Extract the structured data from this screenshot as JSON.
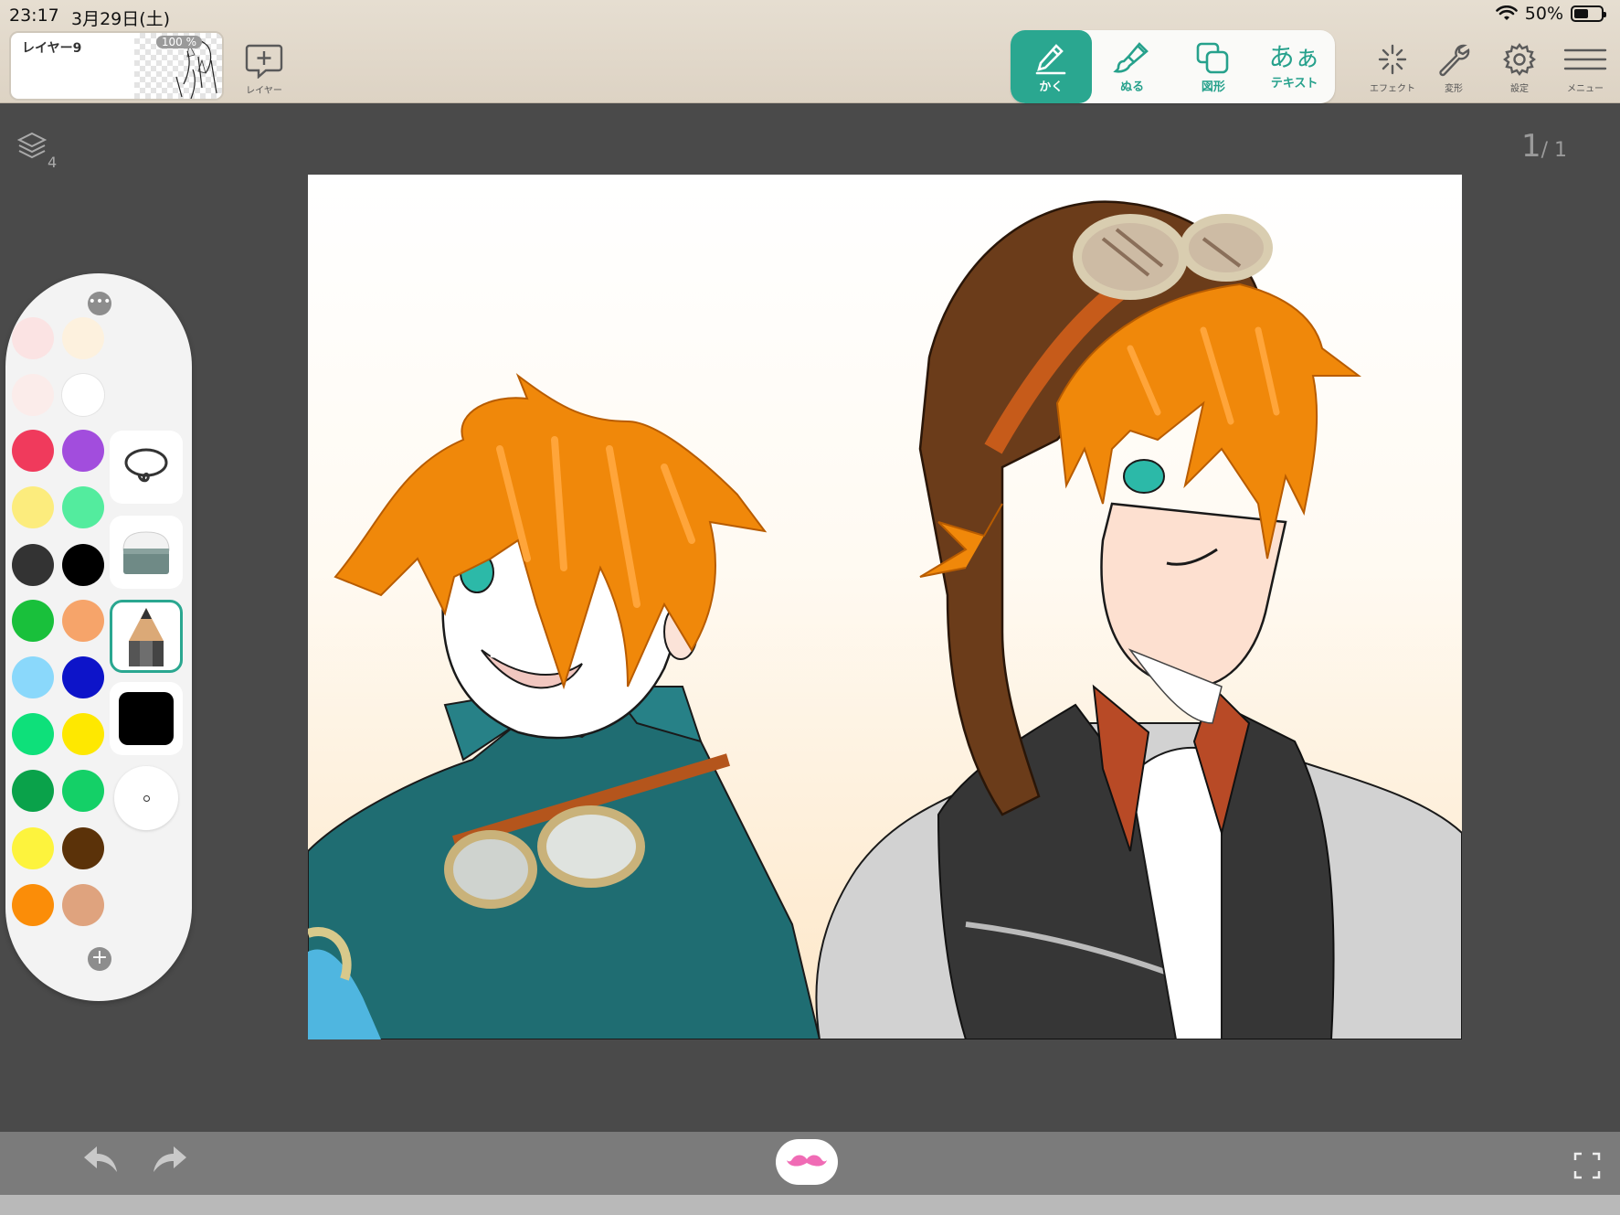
{
  "status_bar": {
    "time": "23:17",
    "date": "3月29日(土)",
    "battery": "50%",
    "battery_level": 0.5
  },
  "layer": {
    "name": "レイヤー9",
    "opacity": "100 %"
  },
  "top_tools": {
    "add_layer": "レイヤー",
    "effect": "エフェクト",
    "transform": "変形",
    "settings": "設定",
    "menu": "メニュー"
  },
  "tool_group": [
    {
      "label": "かく",
      "icon": "pencil-icon",
      "active": true
    },
    {
      "label": "ぬる",
      "icon": "brush-icon",
      "active": false
    },
    {
      "label": "図形",
      "icon": "shape-icon",
      "active": false
    },
    {
      "label": "テキスト",
      "glyph": "あぁ",
      "icon": "text-icon",
      "active": false
    }
  ],
  "workspace": {
    "layer_count": "4",
    "page_current": "1",
    "page_total": "1"
  },
  "palette": {
    "colors": [
      "#fbe3e3",
      "#fdf1de",
      "#fbecea",
      "#ffffff",
      "#f03a5c",
      "#a24ddd",
      "#fcec7d",
      "#53ec9e",
      "#333333",
      "#000000",
      "#19c03b",
      "#f6a46a",
      "#8ad8fb",
      "#0d14c9",
      "#0ee07a",
      "#fee800",
      "#0aa24a",
      "#14d067",
      "#fdf33d",
      "#5b3209",
      "#fb8d08",
      "#dfa37e"
    ],
    "tools": [
      "lasso-icon",
      "eraser-icon",
      "pencil-tool-icon",
      "color-swatch-black",
      "brush-size-icon"
    ],
    "current_color": "#000000"
  },
  "accent_color": "#2aa790"
}
